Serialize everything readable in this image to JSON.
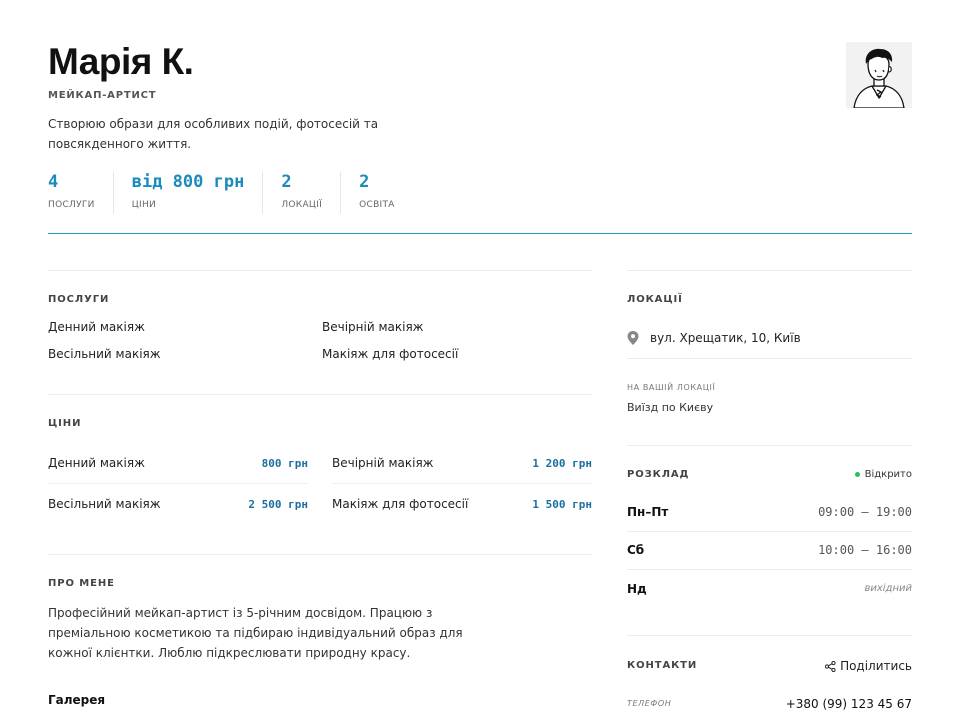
{
  "profile": {
    "name": "Марія К.",
    "role": "МЕЙКАП-АРТИСТ",
    "bio": "Створюю образи для особливих подій, фотосесій та повсякденного життя."
  },
  "stats": [
    {
      "value": "4",
      "label": "ПОСЛУГИ"
    },
    {
      "value": "від 800 грн",
      "label": "ЦІНИ"
    },
    {
      "value": "2",
      "label": "ЛОКАЦІЇ"
    },
    {
      "value": "2",
      "label": "ОСВІТА"
    }
  ],
  "services": {
    "title": "ПОСЛУГИ",
    "items": [
      "Денний макіяж",
      "Вечірній макіяж",
      "Весільний макіяж",
      "Макіяж для фотосесії"
    ]
  },
  "prices": {
    "title": "ЦІНИ",
    "items": [
      {
        "name": "Денний макіяж",
        "price": "800 грн"
      },
      {
        "name": "Вечірній макіяж",
        "price": "1 200 грн"
      },
      {
        "name": "Весільний макіяж",
        "price": "2 500 грн"
      },
      {
        "name": "Макіяж для фотосесії",
        "price": "1 500 грн"
      }
    ]
  },
  "about": {
    "title": "ПРО МЕНЕ",
    "text": "Професійний мейкап-артист із 5-річним досвідом. Працюю з преміальною косметикою та підбираю індивідуальний образ для кожної клієнтки. Люблю підкреслювати природну красу.",
    "gallery_label": "Галерея"
  },
  "locations": {
    "title": "ЛОКАЦІЇ",
    "address": "вул. Хрещатик, 10, Київ",
    "client_label": "НА ВАШІЙ ЛОКАЦІЇ",
    "client_text": "Виїзд по Києву",
    "icon": "map-pin-icon"
  },
  "schedule": {
    "title": "РОЗКЛАД",
    "status": "Відкрито",
    "status_color": "#2bbf5b",
    "rows": [
      {
        "day": "Пн–Пт",
        "time": "09:00 — 19:00"
      },
      {
        "day": "Сб",
        "time": "10:00 — 16:00"
      },
      {
        "day": "Нд",
        "time": "вихідний"
      }
    ]
  },
  "contacts": {
    "title": "КОНТАКТИ",
    "share_label": "Поділитись",
    "phone_label": "ТЕЛЕФОН",
    "phone": "+380 (99) 123 45 67"
  },
  "colors": {
    "accent": "#1a8bbd",
    "price": "#1a6fa0",
    "rule": "#2b9ac9"
  }
}
